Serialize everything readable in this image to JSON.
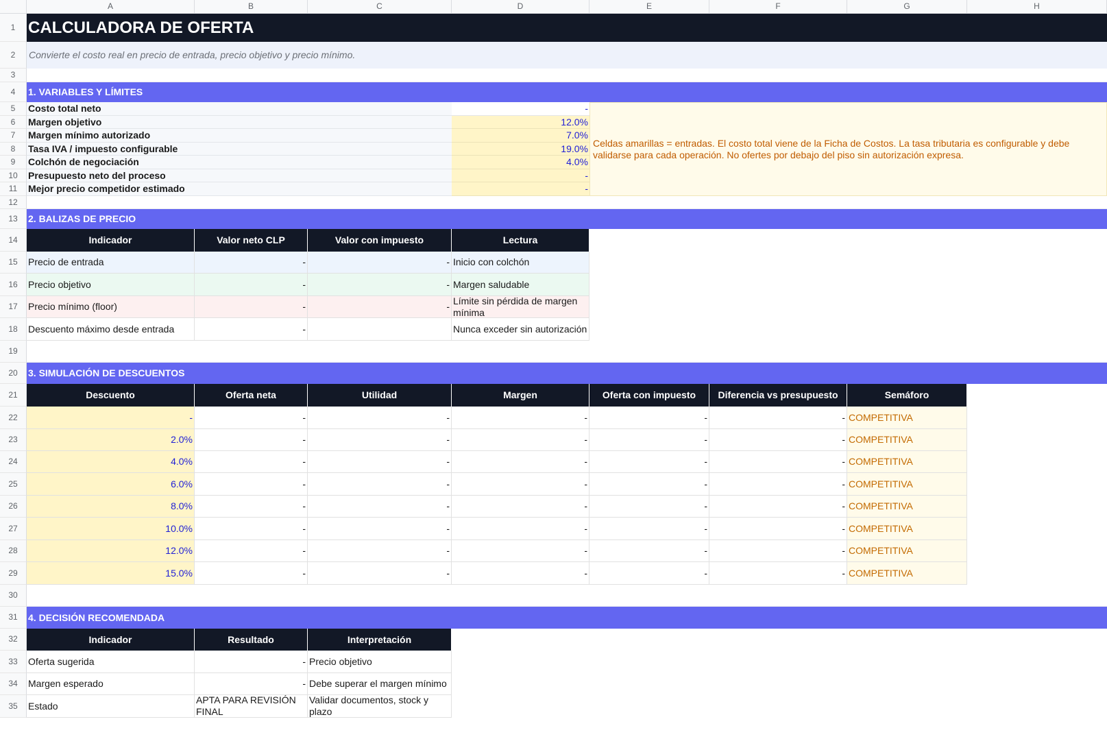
{
  "columns": [
    "A",
    "B",
    "C",
    "D",
    "E",
    "F",
    "G",
    "H"
  ],
  "rows": [
    "1",
    "2",
    "3",
    "4",
    "5",
    "6",
    "7",
    "8",
    "9",
    "10",
    "11",
    "12",
    "13",
    "14",
    "15",
    "16",
    "17",
    "18",
    "19",
    "20",
    "21",
    "22",
    "23",
    "24",
    "25",
    "26",
    "27",
    "28",
    "29",
    "30",
    "31",
    "32",
    "33",
    "34",
    "35"
  ],
  "title": "CALCULADORA DE OFERTA",
  "subtitle": "Convierte el costo real en precio de entrada, precio objetivo y precio mínimo.",
  "section1": {
    "title": "1. VARIABLES Y LÍMITES",
    "rows": [
      {
        "label": "Costo total neto",
        "value": "-"
      },
      {
        "label": "Margen objetivo",
        "value": "12.0%"
      },
      {
        "label": "Margen mínimo autorizado",
        "value": "7.0%"
      },
      {
        "label": "Tasa IVA / impuesto configurable",
        "value": "19.0%"
      },
      {
        "label": "Colchón de negociación",
        "value": "4.0%"
      },
      {
        "label": "Presupuesto neto del proceso",
        "value": "-"
      },
      {
        "label": "Mejor precio competidor estimado",
        "value": "-"
      }
    ],
    "note": "Celdas amarillas = entradas. El costo total viene de la Ficha de Costos. La tasa tributaria es configurable y debe validarse para cada operación. No ofertes por debajo del piso sin autorización expresa."
  },
  "section2": {
    "title": "2. BALIZAS DE PRECIO",
    "headers": [
      "Indicador",
      "Valor neto CLP",
      "Valor con impuesto",
      "Lectura"
    ],
    "rows": [
      {
        "indicator": "Precio de entrada",
        "net": "-",
        "tax": "-",
        "reading": "Inicio con colchón"
      },
      {
        "indicator": "Precio objetivo",
        "net": "-",
        "tax": "-",
        "reading": "Margen saludable"
      },
      {
        "indicator": "Precio mínimo (floor)",
        "net": "-",
        "tax": "-",
        "reading": "Límite sin pérdida de margen mínima"
      },
      {
        "indicator": "Descuento máximo desde entrada",
        "net": "-",
        "tax": "",
        "reading": "Nunca exceder sin autorización"
      }
    ]
  },
  "section3": {
    "title": "3. SIMULACIÓN DE DESCUENTOS",
    "headers": [
      "Descuento",
      "Oferta neta",
      "Utilidad",
      "Margen",
      "Oferta con impuesto",
      "Diferencia vs presupuesto",
      "Semáforo"
    ],
    "rows": [
      {
        "discount": "-",
        "net": "-",
        "profit": "-",
        "margin": "-",
        "tax": "-",
        "diff": "-",
        "status": "COMPETITIVA"
      },
      {
        "discount": "2.0%",
        "net": "-",
        "profit": "-",
        "margin": "-",
        "tax": "-",
        "diff": "-",
        "status": "COMPETITIVA"
      },
      {
        "discount": "4.0%",
        "net": "-",
        "profit": "-",
        "margin": "-",
        "tax": "-",
        "diff": "-",
        "status": "COMPETITIVA"
      },
      {
        "discount": "6.0%",
        "net": "-",
        "profit": "-",
        "margin": "-",
        "tax": "-",
        "diff": "-",
        "status": "COMPETITIVA"
      },
      {
        "discount": "8.0%",
        "net": "-",
        "profit": "-",
        "margin": "-",
        "tax": "-",
        "diff": "-",
        "status": "COMPETITIVA"
      },
      {
        "discount": "10.0%",
        "net": "-",
        "profit": "-",
        "margin": "-",
        "tax": "-",
        "diff": "-",
        "status": "COMPETITIVA"
      },
      {
        "discount": "12.0%",
        "net": "-",
        "profit": "-",
        "margin": "-",
        "tax": "-",
        "diff": "-",
        "status": "COMPETITIVA"
      },
      {
        "discount": "15.0%",
        "net": "-",
        "profit": "-",
        "margin": "-",
        "tax": "-",
        "diff": "-",
        "status": "COMPETITIVA"
      }
    ]
  },
  "section4": {
    "title": "4. DECISIÓN RECOMENDADA",
    "headers": [
      "Indicador",
      "Resultado",
      "Interpretación"
    ],
    "rows": [
      {
        "indicator": "Oferta sugerida",
        "result": "-",
        "interp": "Precio objetivo"
      },
      {
        "indicator": "Margen esperado",
        "result": "-",
        "interp": "Debe superar el margen mínimo"
      },
      {
        "indicator": "Estado",
        "result": "APTA PARA REVISIÓN FINAL",
        "interp": "Validar documentos, stock y plazo"
      }
    ]
  }
}
